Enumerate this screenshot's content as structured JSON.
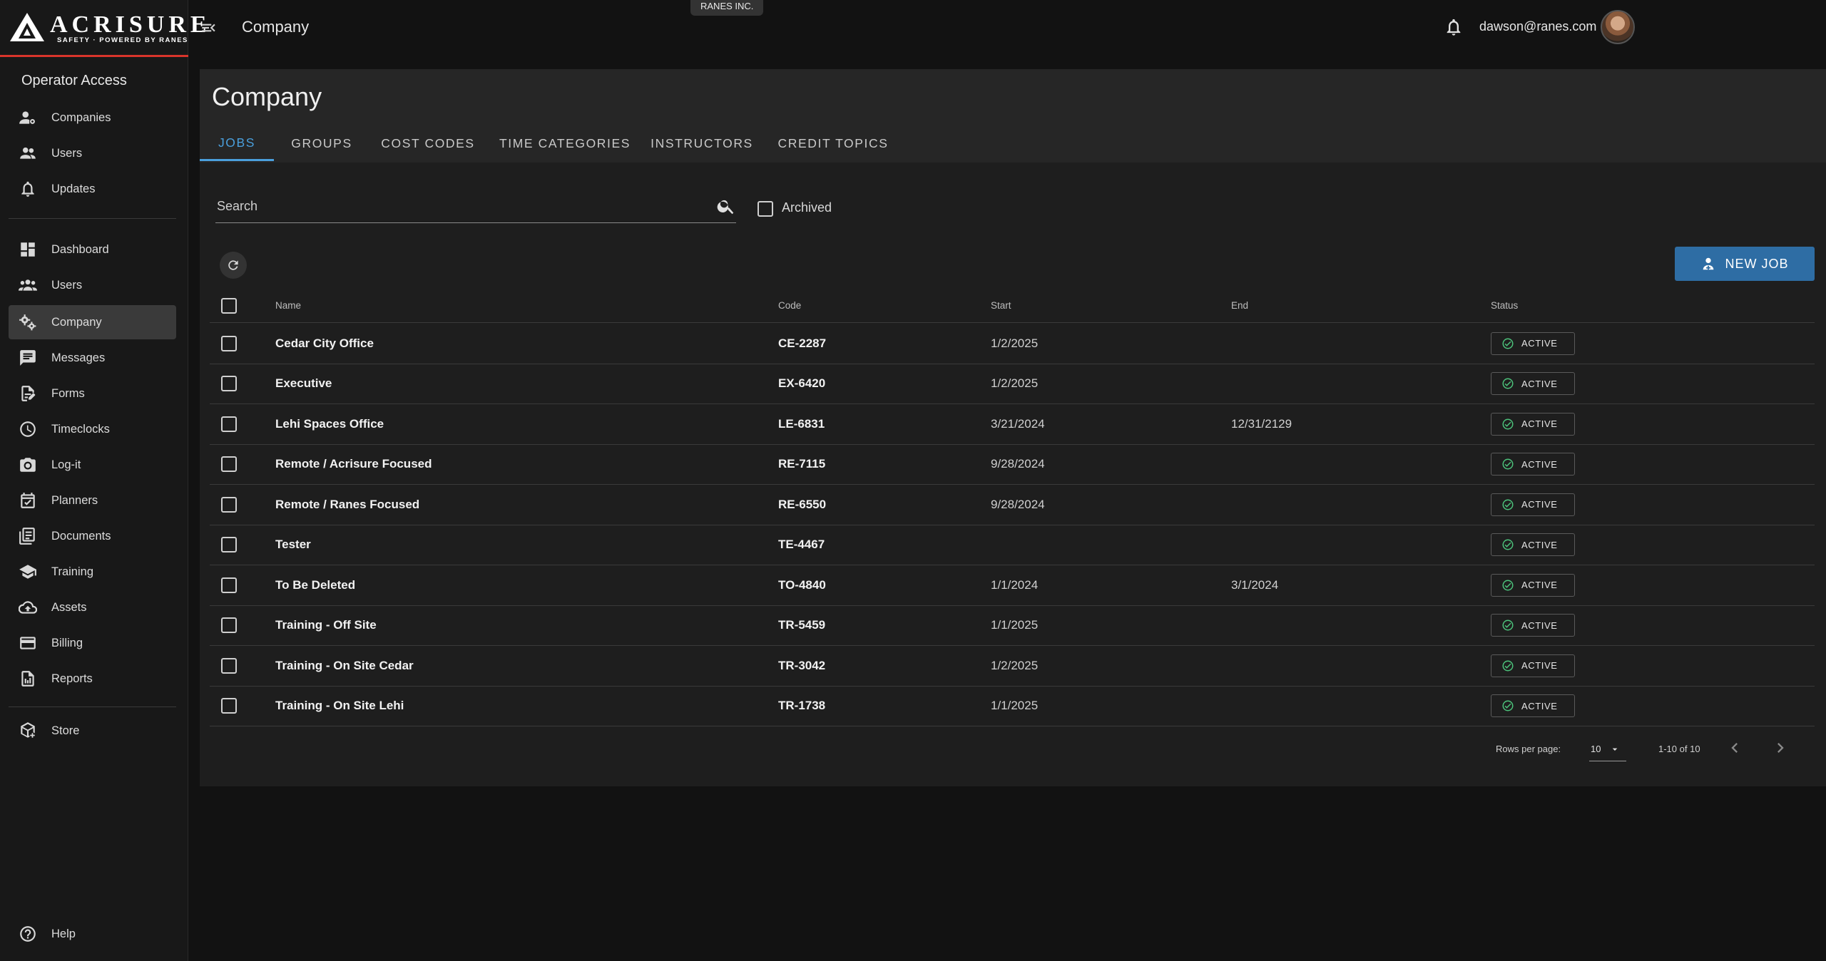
{
  "brand": {
    "name": "ACRISURE",
    "tagline": "SAFETY · POWERED BY RANES"
  },
  "sidebar": {
    "section_title": "Operator Access",
    "operator_items": [
      {
        "label": "Companies",
        "icon": "user-gear-icon"
      },
      {
        "label": "Users",
        "icon": "users-icon"
      },
      {
        "label": "Updates",
        "icon": "bell-icon"
      }
    ],
    "items": [
      {
        "label": "Dashboard",
        "icon": "dashboard-icon"
      },
      {
        "label": "Users",
        "icon": "users-icon"
      },
      {
        "label": "Company",
        "icon": "gears-icon",
        "active": true
      },
      {
        "label": "Messages",
        "icon": "message-icon"
      },
      {
        "label": "Forms",
        "icon": "form-edit-icon"
      },
      {
        "label": "Timeclocks",
        "icon": "clock-icon"
      },
      {
        "label": "Log-it",
        "icon": "camera-icon"
      },
      {
        "label": "Planners",
        "icon": "calendar-check-icon"
      },
      {
        "label": "Documents",
        "icon": "documents-icon"
      },
      {
        "label": "Training",
        "icon": "school-icon"
      },
      {
        "label": "Assets",
        "icon": "cloud-upload-icon"
      },
      {
        "label": "Billing",
        "icon": "credit-card-icon"
      },
      {
        "label": "Reports",
        "icon": "report-icon"
      }
    ],
    "store": {
      "label": "Store",
      "icon": "package-icon"
    },
    "help": {
      "label": "Help",
      "icon": "help-icon"
    }
  },
  "topbar": {
    "title": "Company",
    "environment": "RANES INC.",
    "user_email": "dawson@ranes.com"
  },
  "page": {
    "title": "Company",
    "tabs": [
      "JOBS",
      "GROUPS",
      "COST CODES",
      "TIME CATEGORIES",
      "INSTRUCTORS",
      "CREDIT TOPICS"
    ],
    "active_tab": "JOBS"
  },
  "filters": {
    "search_placeholder": "Search",
    "archived_label": "Archived",
    "archived_checked": false
  },
  "actions": {
    "new_job_label": "NEW JOB"
  },
  "table": {
    "columns": {
      "name": "Name",
      "code": "Code",
      "start": "Start",
      "end": "End",
      "status": "Status"
    },
    "rows": [
      {
        "name": "Cedar City Office",
        "code": "CE-2287",
        "start": "1/2/2025",
        "end": "",
        "status": "ACTIVE"
      },
      {
        "name": "Executive",
        "code": "EX-6420",
        "start": "1/2/2025",
        "end": "",
        "status": "ACTIVE"
      },
      {
        "name": "Lehi Spaces Office",
        "code": "LE-6831",
        "start": "3/21/2024",
        "end": "12/31/2129",
        "status": "ACTIVE"
      },
      {
        "name": "Remote / Acrisure Focused",
        "code": "RE-7115",
        "start": "9/28/2024",
        "end": "",
        "status": "ACTIVE"
      },
      {
        "name": "Remote / Ranes Focused",
        "code": "RE-6550",
        "start": "9/28/2024",
        "end": "",
        "status": "ACTIVE"
      },
      {
        "name": "Tester",
        "code": "TE-4467",
        "start": "",
        "end": "",
        "status": "ACTIVE"
      },
      {
        "name": "To Be Deleted",
        "code": "TO-4840",
        "start": "1/1/2024",
        "end": "3/1/2024",
        "status": "ACTIVE"
      },
      {
        "name": "Training - Off Site",
        "code": "TR-5459",
        "start": "1/1/2025",
        "end": "",
        "status": "ACTIVE"
      },
      {
        "name": "Training - On Site Cedar",
        "code": "TR-3042",
        "start": "1/2/2025",
        "end": "",
        "status": "ACTIVE"
      },
      {
        "name": "Training - On Site Lehi",
        "code": "TR-1738",
        "start": "1/1/2025",
        "end": "",
        "status": "ACTIVE"
      }
    ]
  },
  "pagination": {
    "rows_per_page_label": "Rows per page:",
    "rows_per_page": "10",
    "range": "1-10 of 10"
  },
  "colors": {
    "accent": "#4a9fdc",
    "primary_button": "#2e6da4",
    "status_active": "#4cc27b",
    "brand_red": "#d9352b"
  }
}
